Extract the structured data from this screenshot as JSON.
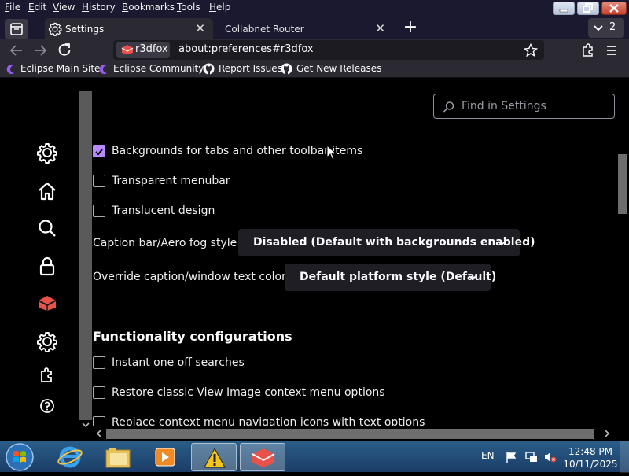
{
  "menubar": {
    "items": [
      {
        "label": "File",
        "underline": "F",
        "rest": "ile"
      },
      {
        "label": "Edit",
        "underline": "E",
        "rest": "dit"
      },
      {
        "label": "View",
        "underline": "V",
        "rest": "iew"
      },
      {
        "label": "History",
        "underline": "H",
        "rest": "istory"
      },
      {
        "label": "Bookmarks",
        "underline": "B",
        "rest": "ookmarks"
      },
      {
        "label": "Tools",
        "underline": "T",
        "rest": "ools"
      },
      {
        "label": "Help",
        "underline": "H",
        "rest": "elp"
      }
    ]
  },
  "tabs": {
    "active": {
      "label": "Settings",
      "icon": "gear-icon"
    },
    "inactive": {
      "label": "Collabnet Router"
    },
    "count": "2"
  },
  "navbar": {
    "identity_label": "r3dfox",
    "url": "about:preferences#r3dfox"
  },
  "bookmarks": [
    {
      "label": "Eclipse Main Site",
      "icon": "eclipse-icon"
    },
    {
      "label": "Eclipse Community",
      "icon": "eclipse-icon"
    },
    {
      "label": "Report Issues",
      "icon": "github-icon"
    },
    {
      "label": "Get New Releases",
      "icon": "github-icon"
    }
  ],
  "search": {
    "placeholder": "Find in Settings"
  },
  "settings": {
    "checkbox_backgrounds": {
      "label": "Backgrounds for tabs and other toolbar items",
      "checked": true
    },
    "checkbox_transparent_menubar": {
      "label": "Transparent menubar",
      "checked": false
    },
    "checkbox_translucent": {
      "label": "Translucent design",
      "checked": false
    },
    "caption_style": {
      "label": "Caption bar/Aero fog style",
      "value": "Disabled (Default with backgrounds enabled)"
    },
    "caption_text_color": {
      "label": "Override caption/window text color",
      "value": "Default platform style (Default)"
    },
    "functionality_heading": "Functionality configurations",
    "checkbox_instant_search": {
      "label": "Instant one off searches",
      "checked": false
    },
    "checkbox_classic_view_image": {
      "label": "Restore classic View Image context menu options",
      "checked": false
    },
    "checkbox_replace_context": {
      "label": "Replace context menu navigation icons with text options",
      "checked": false
    }
  },
  "taskbar": {
    "language": "EN",
    "time": "12:48 PM",
    "date": "10/11/2025"
  },
  "colors": {
    "accent": "#b78bff",
    "titlebar": "#1b1930",
    "toolbar": "#2b2a33"
  }
}
